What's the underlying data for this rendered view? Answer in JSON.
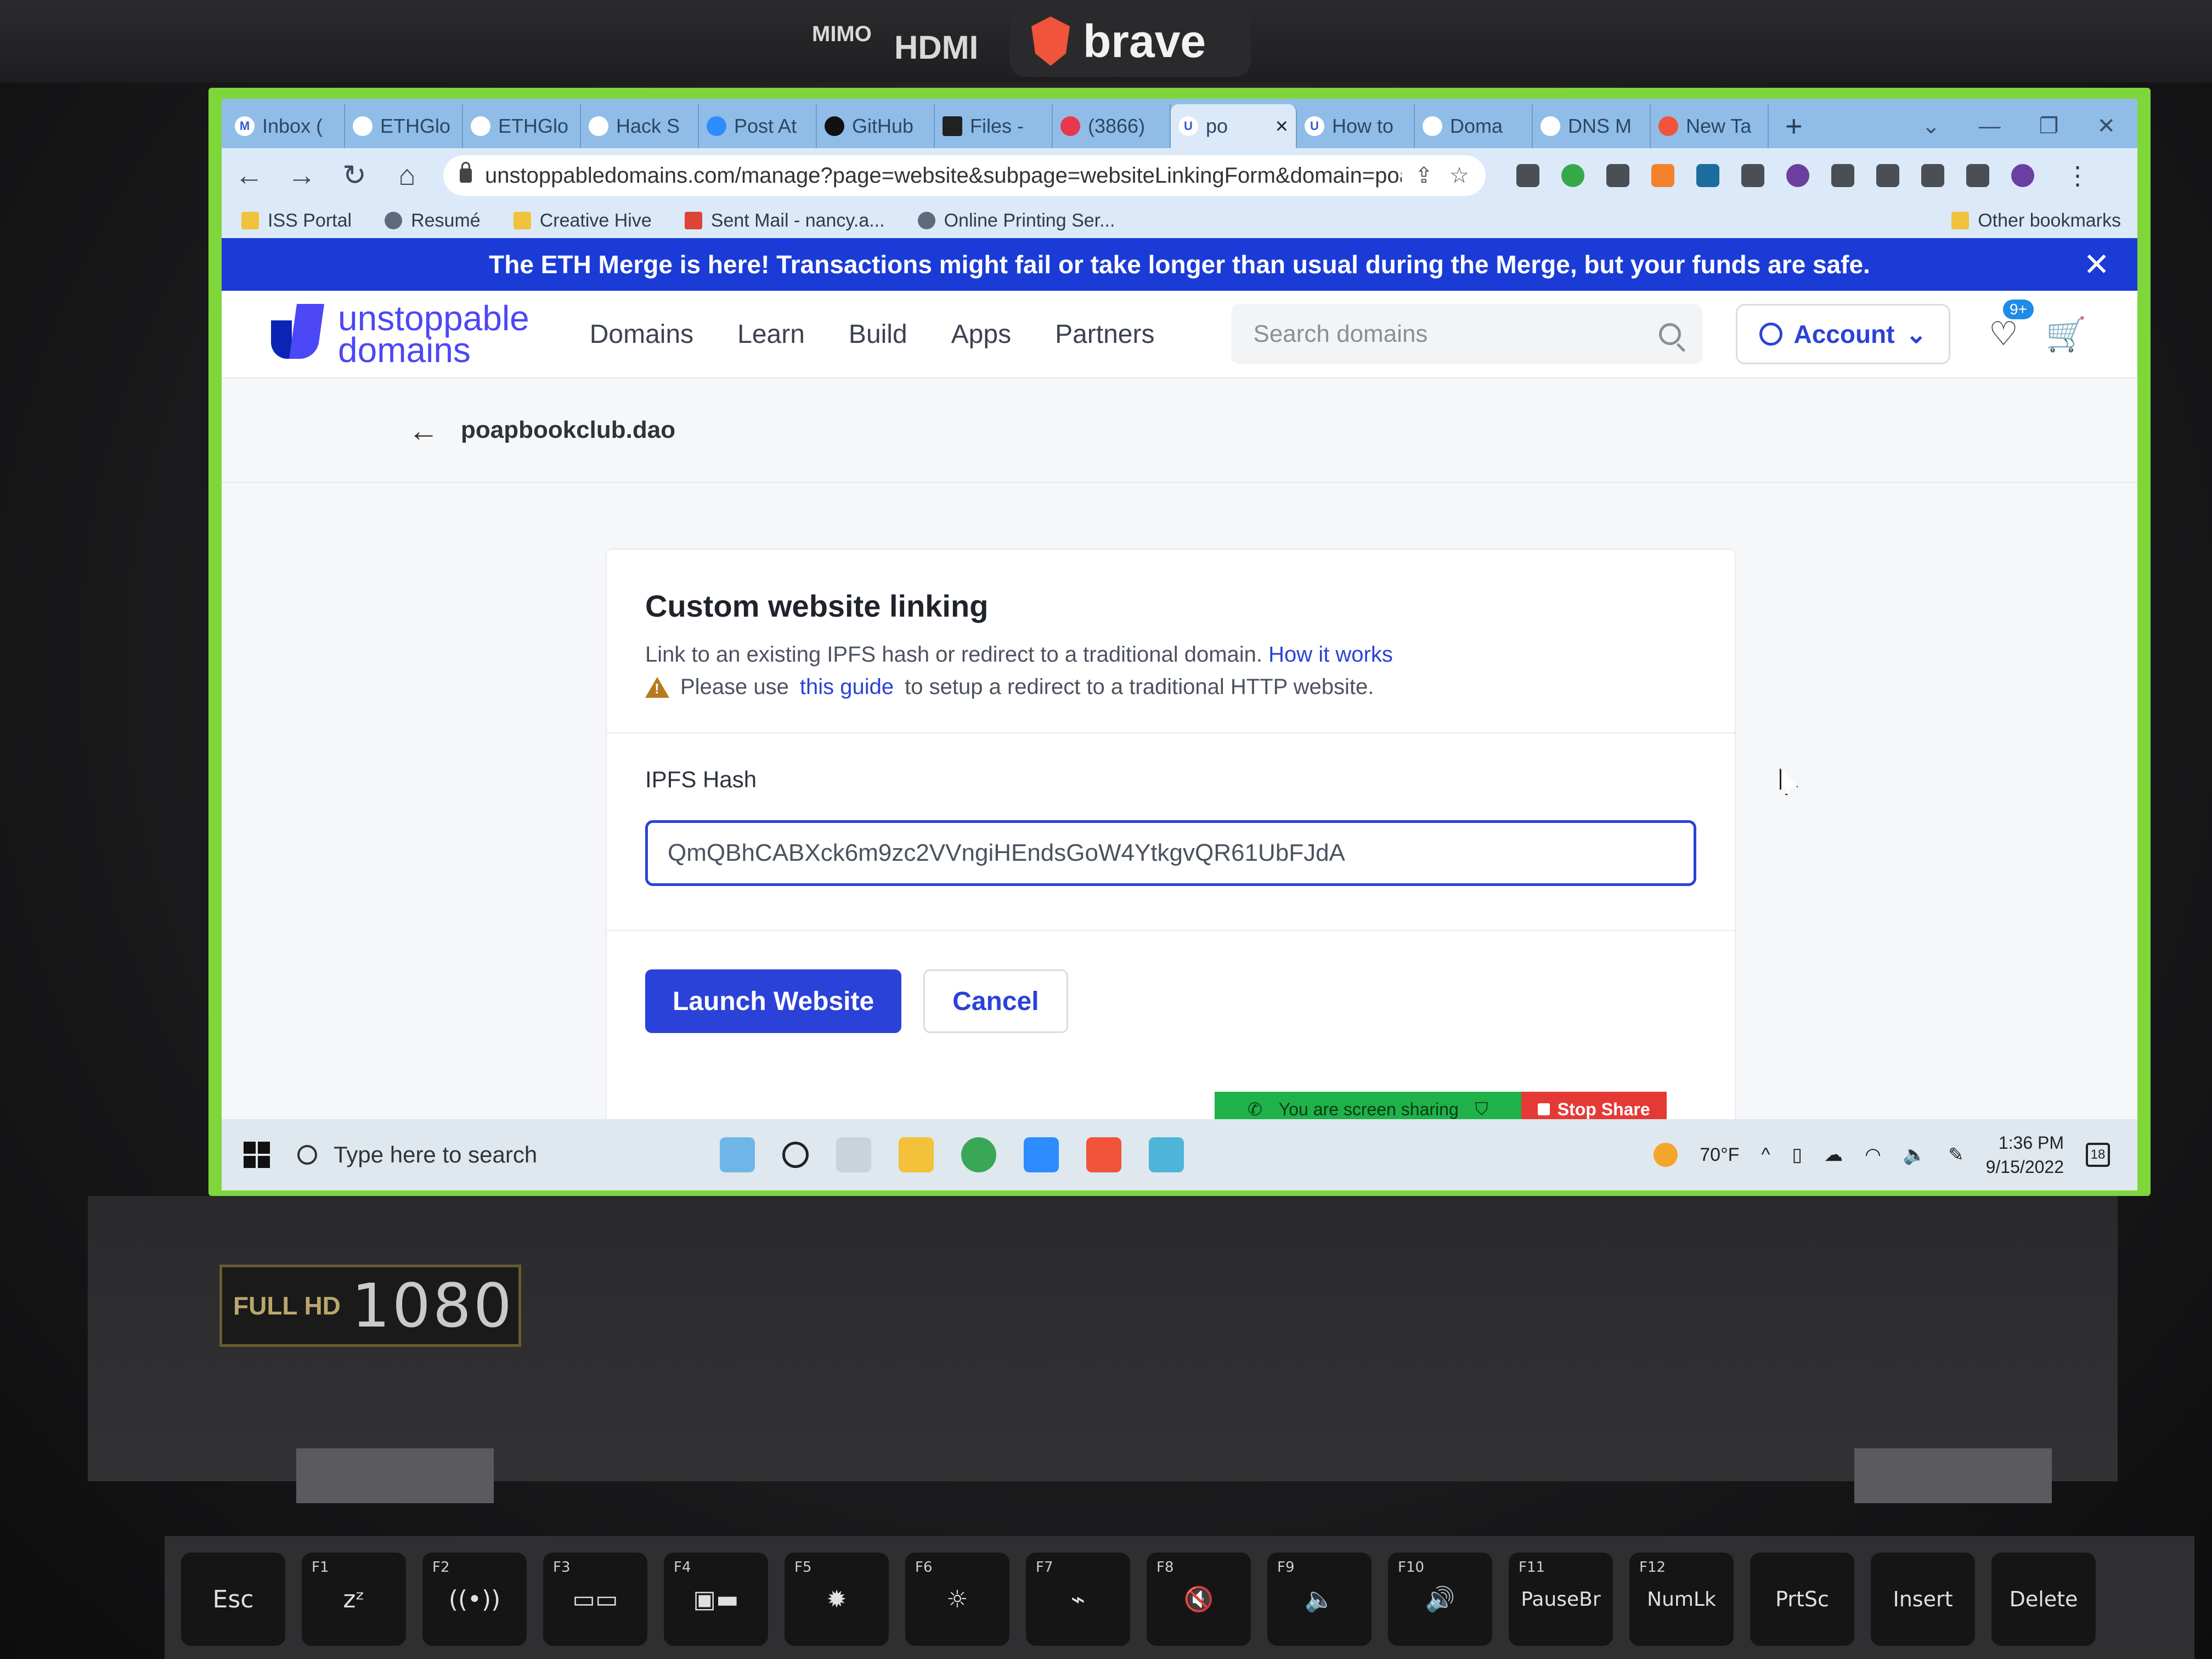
{
  "stickers": {
    "brave": "brave",
    "hdmi": "HDMI",
    "mimo": "MIMO",
    "fullhd": "FULL HD",
    "resolution": "1080"
  },
  "browser": {
    "tabs": [
      {
        "label": "Inbox (",
        "icon": "gmail-icon"
      },
      {
        "label": "ETHGlo",
        "icon": "ethglobal-icon"
      },
      {
        "label": "ETHGlo",
        "icon": "ethglobal-icon"
      },
      {
        "label": "Hack S",
        "icon": "hack-icon"
      },
      {
        "label": "Post At",
        "icon": "zoom-icon"
      },
      {
        "label": "GitHub",
        "icon": "github-icon"
      },
      {
        "label": "Files -",
        "icon": "files-icon"
      },
      {
        "label": "(3866)",
        "icon": "notifications-icon"
      },
      {
        "label": "po",
        "icon": "unstoppable-icon",
        "active": true
      },
      {
        "label": "How to",
        "icon": "unstoppable-icon"
      },
      {
        "label": "Doma",
        "icon": "domain-icon"
      },
      {
        "label": "DNS M",
        "icon": "dns-icon"
      },
      {
        "label": "New Ta",
        "icon": "brave-icon"
      }
    ],
    "url": "unstoppabledomains.com/manage?page=website&subpage=websiteLinkingForm&domain=poa...",
    "bookmarks": [
      {
        "label": "ISS Portal",
        "icon": "folder-icon"
      },
      {
        "label": "Resumé",
        "icon": "globe-icon"
      },
      {
        "label": "Creative Hive",
        "icon": "hive-icon"
      },
      {
        "label": "Sent Mail - nancy.a...",
        "icon": "gmail-icon"
      },
      {
        "label": "Online Printing Ser...",
        "icon": "printing-icon"
      }
    ],
    "other_bookmarks": "Other bookmarks"
  },
  "banner": {
    "text": "The ETH Merge is here! Transactions might fail or take longer than usual during the Merge, but your funds are safe."
  },
  "header": {
    "logo_line1": "unstoppable",
    "logo_line2": "domains",
    "nav": [
      "Domains",
      "Learn",
      "Build",
      "Apps",
      "Partners"
    ],
    "search_placeholder": "Search domains",
    "account_label": "Account",
    "favorites_badge": "9+"
  },
  "breadcrumb": {
    "domain": "poapbookclub.dao"
  },
  "card": {
    "title": "Custom website linking",
    "desc_prefix": "Link to an existing IPFS hash or redirect to a traditional domain.",
    "desc_link": "How it works",
    "warn_prefix": "Please use",
    "warn_link": "this guide",
    "warn_suffix": "to setup a redirect to a traditional HTTP website.",
    "field_label": "IPFS Hash",
    "ipfs_value": "QmQBhCABXck6m9zc2VVngiHEndsGoW4YtkgvQR61UbFJdA",
    "launch_label": "Launch Website",
    "cancel_label": "Cancel"
  },
  "screenshare": {
    "status": "You are screen sharing",
    "stop": "Stop Share"
  },
  "taskbar": {
    "search_placeholder": "Type here to search",
    "weather": "70°F",
    "time": "1:36 PM",
    "date": "9/15/2022",
    "notifications": "18"
  },
  "keyboard": {
    "keys": [
      {
        "top": "",
        "main": "Esc"
      },
      {
        "top": "F1",
        "main": "zᶻ"
      },
      {
        "top": "F2",
        "main": "((•))"
      },
      {
        "top": "F3",
        "main": "▭▭"
      },
      {
        "top": "F4",
        "main": "▣▬"
      },
      {
        "top": "F5",
        "main": "✹"
      },
      {
        "top": "F6",
        "main": "☼"
      },
      {
        "top": "F7",
        "main": "⌁"
      },
      {
        "top": "F8",
        "main": "🔇"
      },
      {
        "top": "F9",
        "main": "🔈"
      },
      {
        "top": "F10",
        "main": "🔊"
      },
      {
        "top": "F11",
        "main": "PauseBr"
      },
      {
        "top": "F12",
        "main": "NumLk"
      },
      {
        "top": "",
        "main": "PrtSc"
      },
      {
        "top": "",
        "main": "Insert"
      },
      {
        "top": "",
        "main": "Delete"
      }
    ]
  },
  "colors": {
    "brand_blue": "#2b42d8",
    "banner_blue": "#1b3bd6",
    "share_green": "#1fb14a",
    "stop_red": "#e53935"
  }
}
